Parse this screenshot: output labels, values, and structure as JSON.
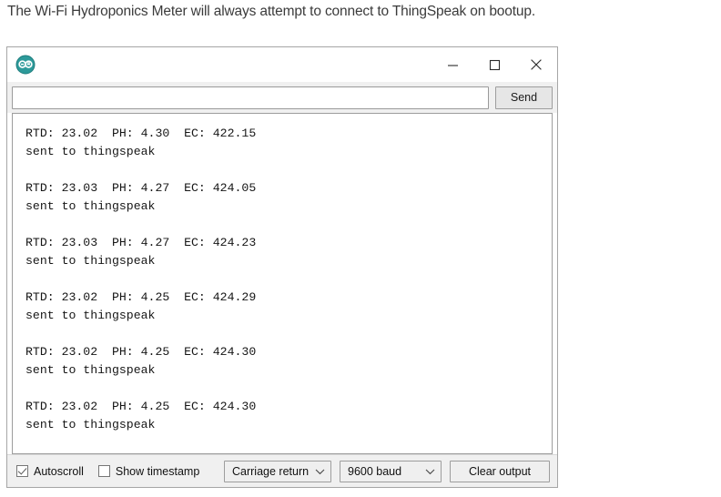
{
  "caption": {
    "text": "The Wi-Fi Hydroponics Meter will always attempt to connect to ThingSpeak on bootup."
  },
  "window": {
    "app_icon_name": "arduino-infinity-icon",
    "title": "",
    "accent_color": "#2d9a9a",
    "controls": {
      "minimize_label": "─",
      "maximize_label": "☐",
      "close_label": "✕"
    }
  },
  "send_bar": {
    "input_value": "",
    "input_placeholder": "",
    "send_label": "Send"
  },
  "console": {
    "blocks": [
      {
        "reading": "RTD: 23.02  PH: 4.30  EC: 422.15",
        "status": "sent to thingspeak"
      },
      {
        "reading": "RTD: 23.03  PH: 4.27  EC: 424.05",
        "status": "sent to thingspeak"
      },
      {
        "reading": "RTD: 23.03  PH: 4.27  EC: 424.23",
        "status": "sent to thingspeak"
      },
      {
        "reading": "RTD: 23.02  PH: 4.25  EC: 424.29",
        "status": "sent to thingspeak"
      },
      {
        "reading": "RTD: 23.02  PH: 4.25  EC: 424.30",
        "status": "sent to thingspeak"
      },
      {
        "reading": "RTD: 23.02  PH: 4.25  EC: 424.30",
        "status": "sent to thingspeak"
      }
    ]
  },
  "bottom_bar": {
    "autoscroll_label": "Autoscroll",
    "autoscroll_checked": true,
    "show_timestamp_label": "Show timestamp",
    "show_timestamp_checked": false,
    "line_ending_value": "Carriage return",
    "baud_value": "9600 baud",
    "clear_label": "Clear output"
  }
}
